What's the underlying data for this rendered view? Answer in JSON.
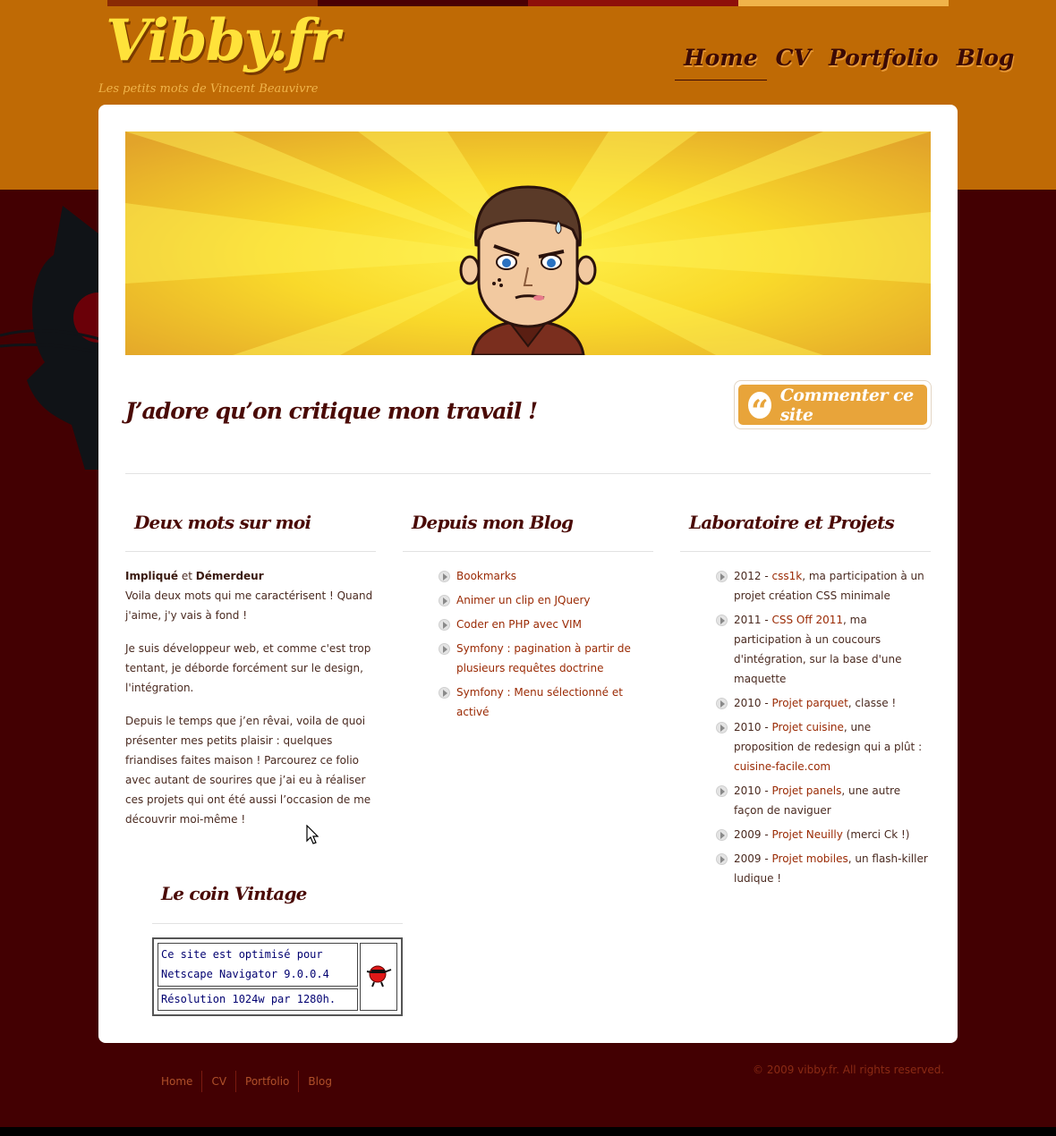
{
  "site": {
    "logo": "Vibby.fr",
    "tagline": "Les petits mots de Vincent Beauvivre"
  },
  "nav": [
    {
      "label": "Home",
      "active": true
    },
    {
      "label": "CV",
      "active": false
    },
    {
      "label": "Portfolio",
      "active": false
    },
    {
      "label": "Blog",
      "active": false
    }
  ],
  "intro": {
    "quote": "J’adore qu’on critique mon travail !",
    "comment_button": "Commenter ce site",
    "quote_icon": "quote-icon"
  },
  "about": {
    "title": "Deux mots sur moi",
    "strong1": "Impliqué",
    "and": " et ",
    "strong2": "Démerdeur",
    "line1": "Voila deux mots qui me caractérisent ! Quand j'aime, j'y vais à fond !",
    "p2": "Je suis développeur web, et comme c'est trop tentant, je déborde forcément sur le design, l'intégration.",
    "p3": "Depuis le temps que j’en rêvai, voila de quoi présenter mes petits plaisir : quelques friandises faites maison ! Parcourez ce folio avec autant de sourires que j’ai eu à réaliser ces projets qui ont été aussi l’occasion de me découvrir moi-même !"
  },
  "blog": {
    "title": "Depuis mon Blog",
    "items": [
      "Bookmarks",
      "Animer un clip en JQuery",
      "Coder en PHP avec VIM",
      "Symfony : pagination à partir de plusieurs requêtes doctrine",
      "Symfony : Menu sélectionné et activé"
    ]
  },
  "lab": {
    "title": "Laboratoire et Projets",
    "items": [
      {
        "pre": "2012 - ",
        "link": "css1k",
        "post": ", ma participation à un projet création CSS minimale"
      },
      {
        "pre": "2011 - ",
        "link": "CSS Off 2011",
        "post": ", ma participation à un coucours d'intégration, sur la base d'une maquette"
      },
      {
        "pre": "2010 - ",
        "link": "Projet parquet",
        "post": ", classe !"
      },
      {
        "pre": "2010 - ",
        "link": "Projet cuisine",
        "post": ", une proposition de redesign qui a plût : ",
        "link2": "cuisine-facile.com"
      },
      {
        "pre": "2010 - ",
        "link": "Projet panels",
        "post": ", une autre façon de naviguer"
      },
      {
        "pre": "2009 - ",
        "link": "Projet Neuilly",
        "post": " (merci Ck !)"
      },
      {
        "pre": "2009 - ",
        "link": "Projet mobiles",
        "post": ", un flash-killer ludique !"
      }
    ]
  },
  "vintage": {
    "title": "Le coin Vintage",
    "line1": "Ce site est optimisé pour Netscape Navigator 9.0.0.4",
    "line2": "Résolution 1024w par 1280h."
  },
  "footer": {
    "links": [
      "Home",
      "CV",
      "Portfolio",
      "Blog"
    ],
    "copyright": "© 2009 vibby.fr. All rights reserved."
  },
  "colors": {
    "orange_band": "#bf6a05",
    "dark_bg": "#430002",
    "logo_yellow": "#ffe23a",
    "link": "#9a2a04",
    "button": "#e8a43a"
  }
}
